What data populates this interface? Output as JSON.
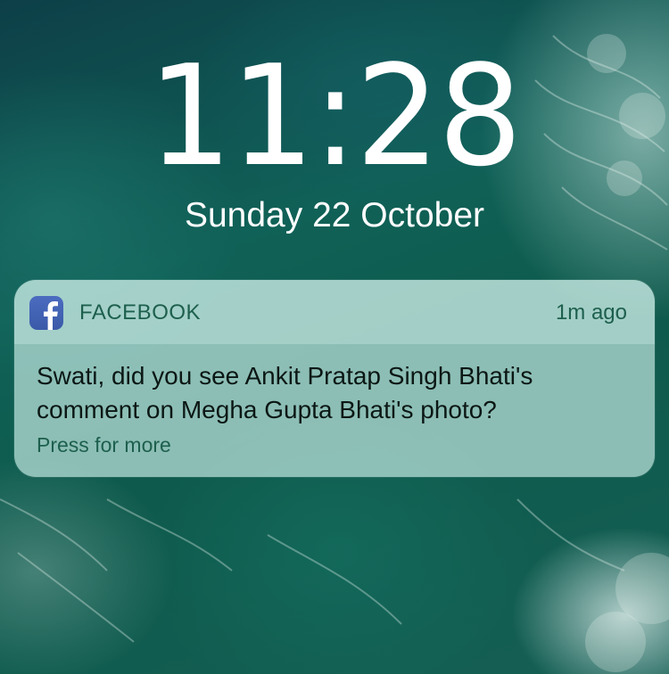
{
  "lock_screen": {
    "time": "11:28",
    "date": "Sunday 22 October"
  },
  "notification": {
    "app_icon": "facebook-icon",
    "app_name": "FACEBOOK",
    "timestamp": "1m ago",
    "message_line1": "Swati, did you see Ankit Pratap Singh Bhati's",
    "message_line2": "comment on Megha Gupta Bhati's photo?",
    "action_hint": "Press for more"
  },
  "colors": {
    "wallpaper_base": "#0f4f4c",
    "notification_accent": "#1d5f4d",
    "facebook_blue": "#3b5998"
  }
}
